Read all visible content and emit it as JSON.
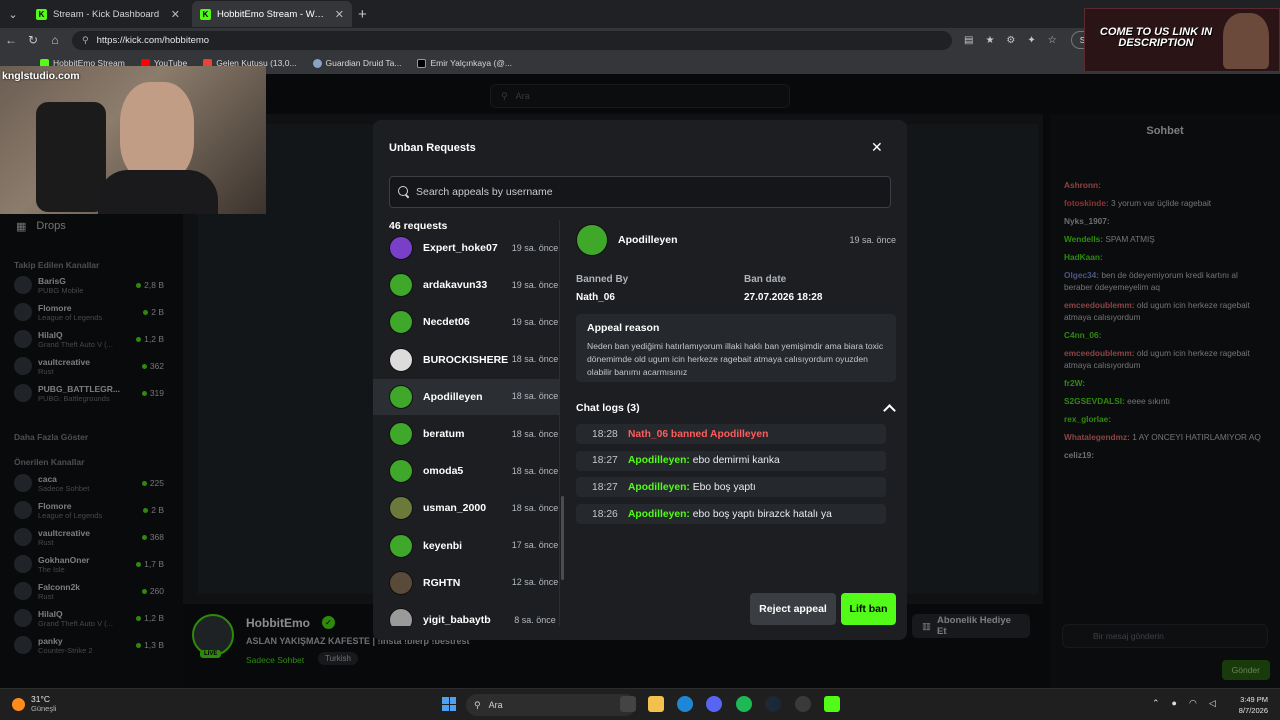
{
  "browser": {
    "tabs": [
      {
        "label": "Stream - Kick Dashboard",
        "active": false
      },
      {
        "label": "HobbitEmo Stream - Watch Live on Kick",
        "active": true
      }
    ],
    "url": "https://kick.com/hobbitemo",
    "profile_label": "Siz oldu",
    "bookmarks": [
      "HobbitEmo Stream",
      "YouTube",
      "Gelen Kutusu (13,0...",
      "Guardian Druid Ta...",
      "Emir Yalçınkaya (@..."
    ]
  },
  "page": {
    "search_placeholder": "Ara",
    "sidebar": {
      "drops_label": "Drops",
      "followed_heading": "Takip Edilen Kanallar",
      "followed": [
        {
          "name": "BarisG",
          "category": "PUBG Mobile",
          "viewers": "2,8 B"
        },
        {
          "name": "Flomore",
          "category": "League of Legends",
          "viewers": "2 B"
        },
        {
          "name": "HilalQ",
          "category": "Grand Theft Auto V (...",
          "viewers": "1,2 B"
        },
        {
          "name": "vaultcreative",
          "category": "Rust",
          "viewers": "362"
        },
        {
          "name": "PUBG_BATTLEGR...",
          "category": "PUBG: Battlegrounds",
          "viewers": "319"
        }
      ],
      "show_more": "Daha Fazla Göster",
      "recommended_heading": "Önerilen Kanallar",
      "recommended": [
        {
          "name": "caca",
          "category": "Sadece Sohbet",
          "viewers": "225"
        },
        {
          "name": "Flomore",
          "category": "League of Legends",
          "viewers": "2 B"
        },
        {
          "name": "vaultcreative",
          "category": "Rust",
          "viewers": "368"
        },
        {
          "name": "GokhanOner",
          "category": "The Isle",
          "viewers": "1,7 B"
        },
        {
          "name": "Falconn2k",
          "category": "Rust",
          "viewers": "260"
        },
        {
          "name": "HilalQ",
          "category": "Grand Theft Auto V (...",
          "viewers": "1,2 B"
        },
        {
          "name": "panky",
          "category": "Counter-Strike 2",
          "viewers": "1,3 B"
        }
      ]
    },
    "streamer": {
      "name": "HobbitEmo",
      "live_label": "LIVE",
      "title": "ASLAN YAKIŞMAZ KAFESTE | !insta !blerp !bestrest",
      "category": "Sadece Sohbet",
      "tag": "Turkish",
      "subscribe_label": "Abonelik Hediye Et"
    },
    "chat": {
      "title": "Sohbet",
      "messages": [
        {
          "user": "Ashronn:",
          "text": "",
          "color": "#ff7b7b"
        },
        {
          "user": "fotoskinde:",
          "text": "3 yorum var üçlide ragebait",
          "color": "#ff5d5d"
        },
        {
          "user": "Nyks_1907:",
          "text": "",
          "color": "#c8c8c8"
        },
        {
          "user": "Wendells:",
          "text": "SPAM ATMIŞ",
          "color": "#53fc18"
        },
        {
          "user": "HadKaan:",
          "text": "",
          "color": "#53fc18"
        },
        {
          "user": "Olgec34:",
          "text": "ben de ödeyemiyorum kredi kartını al beraber ödeyemeyelim aq",
          "color": "#8a9cf0"
        },
        {
          "user": "emceedoublemm:",
          "text": "old ugum icin herkeze ragebait atmaya calısıyordum",
          "color": "#ff7b7b"
        },
        {
          "user": "C4nn_06:",
          "text": "",
          "color": "#53fc18"
        },
        {
          "user": "emceedoublemm:",
          "text": "old ugum icin herkeze ragebait atmaya calısıyordum",
          "color": "#ff7b7b"
        },
        {
          "user": "fr2W:",
          "text": "",
          "color": "#53fc18"
        },
        {
          "user": "S2GSEVDALSI:",
          "text": "eeee sıkıntı",
          "color": "#53fc18"
        },
        {
          "user": "rex_glorlae:",
          "text": "",
          "color": "#53fc18"
        },
        {
          "user": "Whatalegendmz:",
          "text": "1 AY ONCEYI HATIRLAMIYOR AQ",
          "color": "#ff7b7b"
        },
        {
          "user": "celiz19:",
          "text": "",
          "color": "#c8c8c8"
        }
      ],
      "input_placeholder": "Bir mesaj gönderin",
      "send_label": "Gönder",
      "viewer_count": "0"
    }
  },
  "overlay": {
    "webcam_watermark": "knglstudio.com",
    "promo_text": "COME TO US LINK IN DESCRIPTION"
  },
  "modal": {
    "title": "Unban Requests",
    "search_placeholder": "Search appeals by username",
    "count_label": "46 requests",
    "requests": [
      {
        "username": "Expert_hoke07",
        "time": "19 sa. önce",
        "avatar_color": "#7a3fc9"
      },
      {
        "username": "ardakavun33",
        "time": "19 sa. önce",
        "avatar_color": "#3fa72a"
      },
      {
        "username": "Necdet06",
        "time": "19 sa. önce",
        "avatar_color": "#3fa72a"
      },
      {
        "username": "BUROCKISHERE",
        "time": "18 sa. önce",
        "avatar_color": "#dcdcdc"
      },
      {
        "username": "Apodilleyen",
        "time": "18 sa. önce",
        "avatar_color": "#3fa72a",
        "active": true
      },
      {
        "username": "beratum",
        "time": "18 sa. önce",
        "avatar_color": "#3fa72a"
      },
      {
        "username": "omoda5",
        "time": "18 sa. önce",
        "avatar_color": "#3fa72a"
      },
      {
        "username": "usman_2000",
        "time": "18 sa. önce",
        "avatar_color": "#6b7a3a"
      },
      {
        "username": "keyenbi",
        "time": "17 sa. önce",
        "avatar_color": "#3fa72a"
      },
      {
        "username": "RGHTN",
        "time": "12 sa. önce",
        "avatar_color": "#5a4a3a"
      },
      {
        "username": "yigit_babaytb",
        "time": "8 sa. önce",
        "avatar_color": "#9a9a9a"
      }
    ],
    "detail": {
      "username": "Apodilleyen",
      "time": "19 sa. önce",
      "banned_by_label": "Banned By",
      "banned_by": "Nath_06",
      "ban_date_label": "Ban date",
      "ban_date": "27.07.2026 18:28",
      "appeal_reason_label": "Appeal reason",
      "appeal_reason": "Neden ban yediğimi hatırlamıyorum illaki haklı ban yemişimdir ama biara toxic dönemimde old ugum icin herkeze ragebait atmaya calısıyordum oyuzden olabilir banımı acarmısınız",
      "chat_logs_label": "Chat logs (3)",
      "logs": [
        {
          "time": "18:28",
          "type": "ban",
          "text": "Nath_06 banned Apodilleyen"
        },
        {
          "time": "18:27",
          "type": "msg",
          "user": "Apodilleyen:",
          "text": "ebo demirmi kanka"
        },
        {
          "time": "18:27",
          "type": "msg",
          "user": "Apodilleyen:",
          "text": "Ebo boş yaptı"
        },
        {
          "time": "18:26",
          "type": "msg",
          "user": "Apodilleyen:",
          "text": "ebo boş yaptı birazck hatalı ya"
        }
      ]
    },
    "reject_label": "Reject appeal",
    "lift_label": "Lift ban"
  },
  "taskbar": {
    "temp": "31°C",
    "weather": "Güneşli",
    "search_label": "Ara",
    "time": "3:49 PM",
    "date": "8/7/2026"
  },
  "colors": {
    "accent": "#53fc18",
    "ban_red": "#ff5d5d",
    "modal_bg": "#1c1e21"
  }
}
